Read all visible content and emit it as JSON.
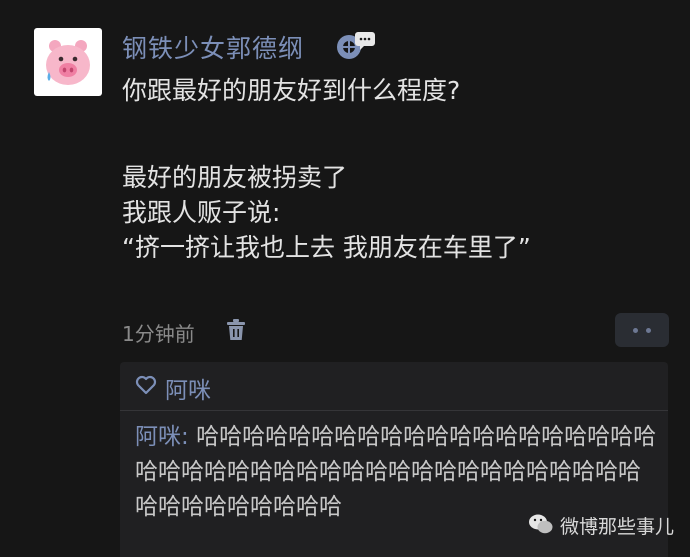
{
  "post": {
    "username": "钢铁少女郭德纲",
    "lines": [
      "你跟最好的朋友好到什么程度?",
      "最好的朋友被拐卖了",
      "我跟人贩子说:",
      "“挤一挤让我也上去 我朋友在车里了”"
    ],
    "timestamp": "1分钟前"
  },
  "likes": {
    "names": "阿咪"
  },
  "comment": {
    "author": "阿咪",
    "separator": ": ",
    "text": "哈哈哈哈哈哈哈哈哈哈哈哈哈哈哈哈哈哈哈哈哈哈哈哈哈哈哈哈哈哈哈哈哈哈哈哈哈哈哈哈哈哈哈哈哈哈哈哈哈哈哈"
  },
  "watermark": {
    "text": "微博那些事儿"
  },
  "colors": {
    "background": "#161616",
    "name_link": "#7c8fb8",
    "panel": "#202022"
  }
}
